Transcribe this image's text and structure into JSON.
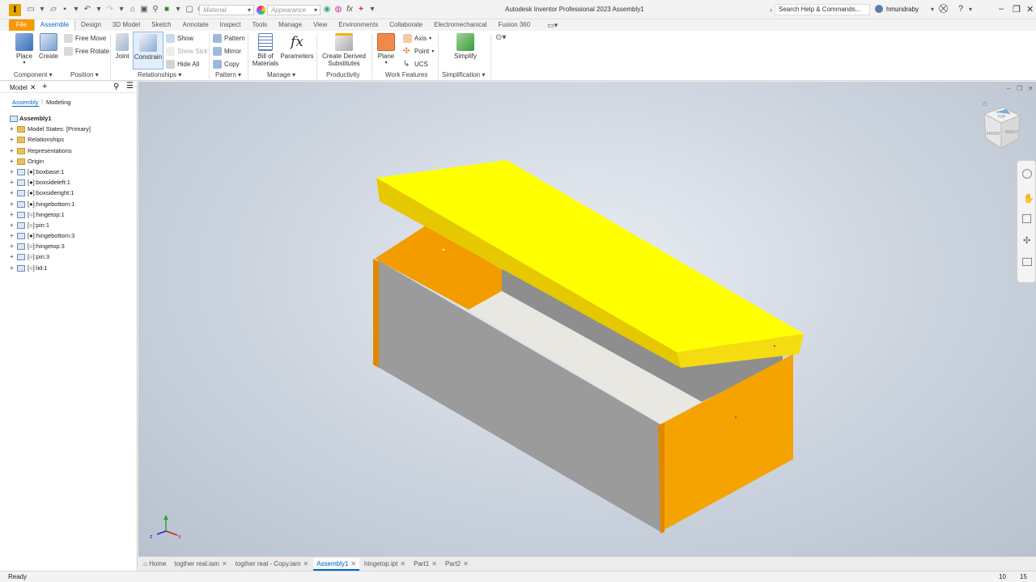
{
  "titlebar": {
    "app_letter": "I",
    "material_placeholder": "Material",
    "appearance_placeholder": "Appearance",
    "title": "Autodesk Inventor Professional 2023    Assembly1",
    "help_search": "Search Help & Commands...",
    "username": "hmundraby"
  },
  "tabs": [
    "File",
    "Assemble",
    "Design",
    "3D Model",
    "Sketch",
    "Annotate",
    "Inspect",
    "Tools",
    "Manage",
    "View",
    "Environments",
    "Collaborate",
    "Electromechanical",
    "Fusion 360"
  ],
  "active_tab": "Assemble",
  "ribbon": {
    "place": "Place",
    "create": "Create",
    "free_move": "Free Move",
    "free_rotate": "Free Rotate",
    "joint": "Joint",
    "constrain": "Constrain",
    "show": "Show",
    "show_sick": "Show Sick",
    "hide_all": "Hide All",
    "pattern": "Pattern",
    "mirror": "Mirror",
    "copy": "Copy",
    "bom_line1": "Bill of",
    "bom_line2": "Materials",
    "parameters": "Parameters",
    "derived_line1": "Create Derived",
    "derived_line2": "Substitutes",
    "plane": "Plane",
    "axis": "Axis",
    "point": "Point",
    "ucs": "UCS",
    "simplify": "Simplify",
    "panels": {
      "component": "Component",
      "position": "Position",
      "relationships": "Relationships",
      "pattern": "Pattern",
      "manage": "Manage",
      "productivity": "Productivity",
      "work_features": "Work Features",
      "simplification": "Simplification"
    }
  },
  "browser": {
    "tab_label": "Model",
    "subtabs": [
      "Assembly",
      "Modeling"
    ],
    "root": "Assembly1",
    "nodes": [
      {
        "label": "Model States: [Primary]",
        "icon": "folder"
      },
      {
        "label": "Relationships",
        "icon": "folder"
      },
      {
        "label": "Representations",
        "icon": "folder"
      },
      {
        "label": "Origin",
        "icon": "folder"
      },
      {
        "label": "[●]:boxbase:1",
        "icon": "component"
      },
      {
        "label": "[●]:boxsideleft:1",
        "icon": "component"
      },
      {
        "label": "[●]:boxsideright:1",
        "icon": "component"
      },
      {
        "label": "[●]:hingebottom:1",
        "icon": "component"
      },
      {
        "label": "[○]:hingetop:1",
        "icon": "component"
      },
      {
        "label": "[○]:pin:1",
        "icon": "component"
      },
      {
        "label": "[●]:hingebottom:3",
        "icon": "component"
      },
      {
        "label": "[○]:hingetop:3",
        "icon": "component"
      },
      {
        "label": "[○]:pin:3",
        "icon": "component"
      },
      {
        "label": "[○]:lid:1",
        "icon": "component"
      }
    ]
  },
  "viewcube": {
    "top": "TOP",
    "front": "FRONT",
    "right": "RIGHT"
  },
  "colors": {
    "lid": "#ffff00",
    "side_orange": "#f5a300",
    "box_gray": "#9a9a9a",
    "accent": "#0066cc",
    "file_tab": "#f59a00"
  },
  "doc_tabs": [
    {
      "label": "Home",
      "active": false,
      "closable": false
    },
    {
      "label": "togther real.iam",
      "active": false,
      "closable": true
    },
    {
      "label": "togther real - Copy.iam",
      "active": false,
      "closable": true
    },
    {
      "label": "Assembly1",
      "active": true,
      "closable": true
    },
    {
      "label": "hingetop.ipt",
      "active": false,
      "closable": true
    },
    {
      "label": "Part1",
      "active": false,
      "closable": true
    },
    {
      "label": "Part2",
      "active": false,
      "closable": true
    }
  ],
  "status": {
    "text": "Ready",
    "count1": "10",
    "count2": "15"
  }
}
